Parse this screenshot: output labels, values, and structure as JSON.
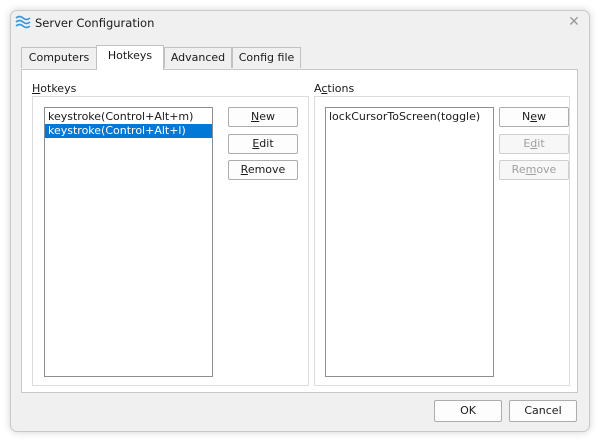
{
  "window": {
    "title": "Server Configuration",
    "close_glyph": "✕"
  },
  "tabs": [
    {
      "label": "Computers",
      "active": false
    },
    {
      "label": "Hotkeys",
      "active": true
    },
    {
      "label": "Advanced",
      "active": false
    },
    {
      "label": "Config file",
      "active": false
    }
  ],
  "hotkeys": {
    "group_label_mnemonic": "H",
    "group_label_rest": "otkeys",
    "items": [
      {
        "text": "keystroke(Control+Alt+m)",
        "selected": false
      },
      {
        "text": "keystroke(Control+Alt+l)",
        "selected": true
      }
    ],
    "buttons": {
      "new": {
        "mnemonic": "N",
        "rest": "ew",
        "enabled": true
      },
      "edit": {
        "mnemonic": "E",
        "rest": "dit",
        "enabled": true
      },
      "remove": {
        "mnemonic": "R",
        "rest": "emove",
        "enabled": true
      }
    }
  },
  "actions": {
    "group_label_prefix": "A",
    "group_label_mnemonic": "c",
    "group_label_rest": "tions",
    "items": [
      {
        "text": "lockCursorToScreen(toggle)",
        "selected": false
      }
    ],
    "buttons": {
      "new_prefix": "N",
      "new_mnemonic": "e",
      "new_rest": "w",
      "edit_prefix": "E",
      "edit_mnemonic": "d",
      "edit_rest": "it",
      "remove_prefix": "Re",
      "remove_mnemonic": "m",
      "remove_rest": "ove",
      "edit_enabled": false,
      "remove_enabled": false
    }
  },
  "dialog_buttons": {
    "ok": "OK",
    "cancel": "Cancel"
  },
  "colors": {
    "selection": "#0078d7",
    "icon": "#3a9ad9"
  }
}
